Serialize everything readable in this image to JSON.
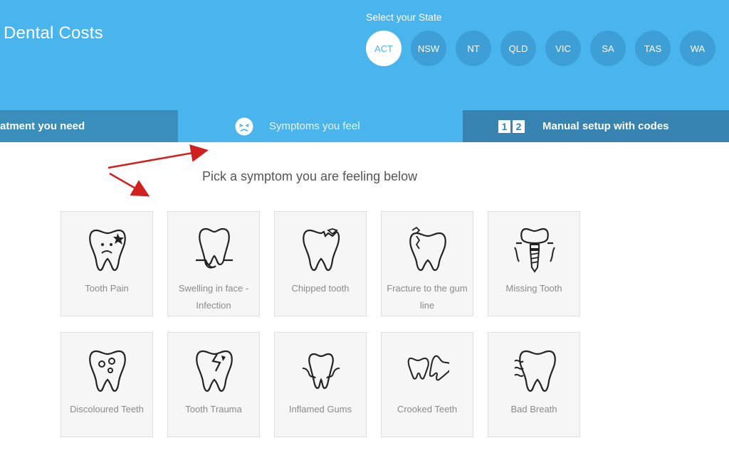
{
  "header": {
    "site_title": "Dental Costs",
    "state_label": "Select your State",
    "states": [
      {
        "label": "ACT",
        "active": true
      },
      {
        "label": "NSW",
        "active": false
      },
      {
        "label": "NT",
        "active": false
      },
      {
        "label": "QLD",
        "active": false
      },
      {
        "label": "VIC",
        "active": false
      },
      {
        "label": "SA",
        "active": false
      },
      {
        "label": "TAS",
        "active": false
      },
      {
        "label": "WA",
        "active": false
      }
    ]
  },
  "tabs": [
    {
      "label": "atment you need",
      "active": false
    },
    {
      "label": "Symptoms you feel",
      "active": true,
      "icon": "sad-face-icon"
    },
    {
      "label": "Manual setup with codes",
      "active": false,
      "icon": "number-boxes-icon",
      "icon_text": [
        "1",
        "2"
      ]
    }
  ],
  "main": {
    "prompt": "Pick a symptom you are feeling below"
  },
  "symptoms": [
    {
      "label": "Tooth Pain",
      "icon": "tooth-pain-icon"
    },
    {
      "label": "Swelling in face - Infection",
      "icon": "swelling-tooth-icon"
    },
    {
      "label": "Chipped tooth",
      "icon": "chipped-tooth-icon"
    },
    {
      "label": "Fracture to the gum line",
      "icon": "fractured-tooth-icon"
    },
    {
      "label": "Missing Tooth",
      "icon": "implant-tooth-icon"
    },
    {
      "label": "Discoloured Teeth",
      "icon": "discoloured-tooth-icon"
    },
    {
      "label": "Tooth Trauma",
      "icon": "trauma-tooth-icon"
    },
    {
      "label": "Inflamed Gums",
      "icon": "inflamed-gums-icon"
    },
    {
      "label": "Crooked Teeth",
      "icon": "crooked-teeth-icon"
    },
    {
      "label": "Bad Breath",
      "icon": "bad-breath-tooth-icon"
    }
  ],
  "colors": {
    "header_bg": "#4ab5ec",
    "tab_bg": "#3a8ebc",
    "arrow": "#d02020",
    "card_bg": "#f6f6f6"
  }
}
